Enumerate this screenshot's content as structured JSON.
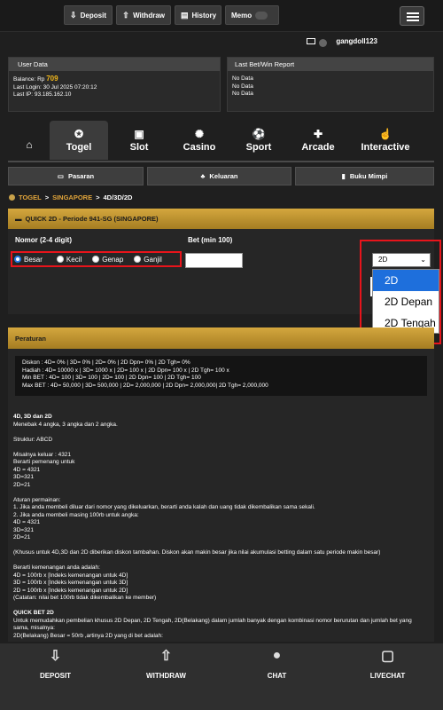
{
  "header": {
    "deposit_label": "Deposit",
    "withdraw_label": "Withdraw",
    "history_label": "History",
    "memo_label": "Memo",
    "username": "gangdoll123"
  },
  "user_data": {
    "title": "User Data",
    "balance_label": "Balance: Rp",
    "balance_value": "709",
    "last_login": "Last Login: 30 Jul 2025 07:20:12",
    "last_ip": "Last IP: 93.185.162.10"
  },
  "last_bet": {
    "title": "Last Bet/Win Report",
    "rows": [
      "No Data",
      "No Data",
      "No Data"
    ]
  },
  "categories": [
    {
      "label": "",
      "icon": "home-icon"
    },
    {
      "label": "Togel",
      "icon": "togel-icon"
    },
    {
      "label": "Slot",
      "icon": "slot-icon"
    },
    {
      "label": "Casino",
      "icon": "casino-icon"
    },
    {
      "label": "Sport",
      "icon": "sport-icon"
    },
    {
      "label": "Arcade",
      "icon": "arcade-icon"
    },
    {
      "label": "Interactive",
      "icon": "interactive-icon"
    }
  ],
  "subnav": {
    "pasaran": "Pasaran",
    "keluaran": "Keluaran",
    "buku_mimpi": "Buku Mimpi"
  },
  "breadcrumb": {
    "togel": "TOGEL",
    "sep1": ">",
    "market": "SINGAPORE",
    "sep2": ">",
    "current": "4D/3D/2D"
  },
  "quick_bet": {
    "title": "QUICK 2D - Periode 941-SG (SINGAPORE)",
    "nomor_label": "Nomor (2-4 digit)",
    "bet_label": "Bet (min 100)",
    "options": [
      "Besar",
      "Kecil",
      "Genap",
      "Ganjil"
    ],
    "selected_option": "Besar",
    "select_value": "2D",
    "dropdown_options": [
      "2D",
      "2D Depan",
      "2D Tengah"
    ],
    "dropdown_selected": "2D"
  },
  "peraturan": {
    "title": "Peraturan",
    "summary": [
      "Diskon : 4D= 0% | 3D= 0% | 2D= 0% | 2D Dpn= 0% | 2D Tgh= 0%",
      "Hadiah : 4D= 10000 x | 3D= 1000 x | 2D= 100 x | 2D Dpn= 100 x | 2D Tgh= 100 x",
      "Min BET : 4D= 100 | 3D= 100 | 2D= 100 | 2D Dpn= 100 | 2D Tgh= 100",
      "Max BET : 4D= 50,000 | 3D= 500,000 | 2D= 2,000,000 | 2D Dpn= 2,000,000| 2D Tgh= 2,000,000"
    ],
    "body": [
      {
        "text": "4D, 3D dan 2D",
        "bold": true
      },
      {
        "text": "Menebak 4 angka, 3 angka dan 2 angka.",
        "bold": false
      },
      {
        "text": "",
        "bold": false
      },
      {
        "text": "Struktur: ABCD",
        "bold": false
      },
      {
        "text": "",
        "bold": false
      },
      {
        "text": "Misalnya keluar : 4321",
        "bold": false
      },
      {
        "text": "Berarti pemenang untuk",
        "bold": false
      },
      {
        "text": "4D = 4321",
        "bold": false
      },
      {
        "text": "3D=321",
        "bold": false
      },
      {
        "text": "2D=21",
        "bold": false
      },
      {
        "text": "",
        "bold": false
      },
      {
        "text": "Aturan permainan:",
        "bold": false
      },
      {
        "text": "1. Jika anda membeli diluar dari nomor yang dikeluarkan, berarti anda kalah dan uang tidak dikembalikan sama sekali.",
        "bold": false
      },
      {
        "text": "2. Jika anda membeli masing 100rb untuk angka:",
        "bold": false
      },
      {
        "text": "4D = 4321",
        "bold": false
      },
      {
        "text": "3D=321",
        "bold": false
      },
      {
        "text": "2D=21",
        "bold": false
      },
      {
        "text": "",
        "bold": false
      },
      {
        "text": "(Khusus untuk 4D,3D dan 2D diberikan diskon tambahan. Diskon akan makin besar jika nilai akumulasi betting dalam satu periode makin besar)",
        "bold": false
      },
      {
        "text": "",
        "bold": false
      },
      {
        "text": "Berarti kemenangan anda adalah:",
        "bold": false
      },
      {
        "text": "4D = 100rb x [Indeks kemenangan untuk 4D]",
        "bold": false
      },
      {
        "text": "3D = 100rb x [Indeks kemenangan untuk 3D]",
        "bold": false
      },
      {
        "text": "2D = 100rb x [Indeks kemenangan untuk 2D]",
        "bold": false
      },
      {
        "text": "(Catatan: nilai bet 100rb tidak dikembalikan ke member)",
        "bold": false
      },
      {
        "text": "",
        "bold": false
      },
      {
        "text": "QUICK BET 2D",
        "bold": true
      },
      {
        "text": "Untuk memudahkan pembelian khusus 2D Depan, 2D Tengah, 2D(Belakang) dalam jumlah banyak dengan kombinasi nomor berurutan dan jumlah bet yang sama, misalnya:",
        "bold": false
      },
      {
        "text": "2D(Belakang) Besar = 50rb ,artinya 2D yang di bet adalah:",
        "bold": false
      }
    ]
  },
  "bottom_nav": [
    {
      "label": "DEPOSIT",
      "icon": "deposit-icon"
    },
    {
      "label": "WITHDRAW",
      "icon": "withdraw-icon"
    },
    {
      "label": "CHAT",
      "icon": "chat-icon"
    },
    {
      "label": "LIVECHAT",
      "icon": "livechat-icon"
    }
  ],
  "colors": {
    "accent_gold": "#f4b91b",
    "highlight_red": "#e8141b",
    "select_blue": "#1e6fdc"
  }
}
